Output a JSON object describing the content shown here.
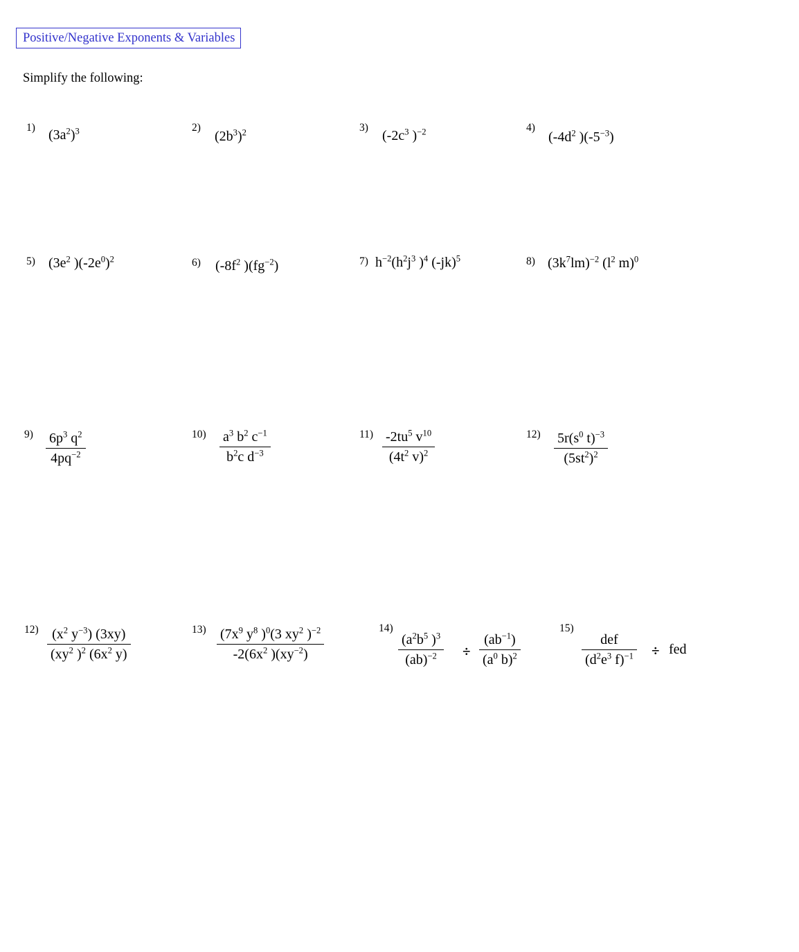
{
  "document": {
    "title": "Positive/Negative Exponents & Variables",
    "instruction": "Simplify the following:",
    "title_border_color": "#3333cc",
    "title_text_color": "#3333cc",
    "background_color": "#ffffff",
    "text_color": "#000000"
  },
  "problems": [
    {
      "number": "1)",
      "kind": "inline",
      "plain": "(3a^2)^3",
      "html": "(3a<sup>2</sup>)<sup>3</sup>"
    },
    {
      "number": "2)",
      "kind": "inline",
      "plain": "(2b^3)^2",
      "html": "(2b<sup>3</sup>)<sup>2</sup>"
    },
    {
      "number": "3)",
      "kind": "inline",
      "plain": "(-2c^3)^-2",
      "html": "(-2c<sup>3</sup> )<sup>&#8722;2</sup>"
    },
    {
      "number": "4)",
      "kind": "inline",
      "plain": "(-4d^2)(-5^-3)",
      "html": "(-4d<sup>2</sup> )(-5<sup>&#8722;3</sup>)"
    },
    {
      "number": "5)",
      "kind": "inline",
      "plain": "(3e^2)(-2e^0)^2",
      "html": "(3e<sup>2</sup> )(-2e<sup>0</sup>)<sup>2</sup>"
    },
    {
      "number": "6)",
      "kind": "inline",
      "plain": "(-8f^2)(fg^-2)",
      "html": "(-8f<sup>2</sup> )(fg<sup>&#8722;2</sup>)"
    },
    {
      "number": "7)",
      "kind": "inline",
      "plain": "h^-2(h^2 j^3)^4 (-jk)^5",
      "html": "h<sup>&#8722;2</sup>(h<sup>2</sup>j<sup>3</sup> )<sup>4</sup> (-jk)<sup>5</sup>"
    },
    {
      "number": "8)",
      "kind": "inline",
      "plain": "(3k^7 lm)^-2 (l^2 m)^0",
      "html": "(3k<sup>7</sup>lm)<sup>&#8722;2</sup> (l<sup>2</sup> m)<sup>0</sup>"
    },
    {
      "number": "9)",
      "kind": "fraction",
      "plain": "6p^3 q^2 / 4pq^-2",
      "numerator_html": "6p<sup>3</sup> q<sup>2</sup>",
      "denominator_html": "4pq<sup>&#8722;2</sup>"
    },
    {
      "number": "10)",
      "kind": "fraction",
      "plain": "a^3 b^2 c^-1 / b^2 c d^-3",
      "numerator_html": "a<sup>3</sup> b<sup>2</sup> c<sup>&#8722;1</sup>",
      "denominator_html": "b<sup>2</sup>c d<sup>&#8722;3</sup>"
    },
    {
      "number": "11)",
      "kind": "fraction",
      "plain": "-2tu^5 v^10 / (4t^2 v)^2",
      "numerator_html": "-2tu<sup>5</sup> v<sup>10</sup>",
      "denominator_html": "(4t<sup>2</sup> v)<sup>2</sup>"
    },
    {
      "number": "12)",
      "kind": "fraction",
      "plain": "5r(s^0 t)^-3 / (5st^2)^2",
      "numerator_html": "5r(s<sup>0</sup> t)<sup>&#8722;3</sup>",
      "denominator_html": "(5st<sup>2</sup>)<sup>2</sup>"
    },
    {
      "number": "12)",
      "kind": "fraction",
      "plain": "(x^2 y^-3)(3xy) / (xy^2)^2 (6x^2 y)",
      "numerator_html": "(x<sup>2</sup> y<sup>&#8722;3</sup>) (3xy)",
      "denominator_html": "(xy<sup>2</sup> )<sup>2</sup> (6x<sup>2</sup> y)"
    },
    {
      "number": "13)",
      "kind": "fraction",
      "plain": "(7x^9 y^8)^0 (3 xy^2)^-2 / -2(6x^2)(xy^-2)",
      "numerator_html": "(7x<sup>9</sup> y<sup>8</sup> )<sup>0</sup>(3 xy<sup>2</sup> )<sup>&#8722;2</sup>",
      "denominator_html": "-2(6x<sup>2</sup> )(xy<sup>&#8722;2</sup>)"
    },
    {
      "number": "14)",
      "kind": "fraction-div-fraction",
      "plain": "(a^2 b^5)^3 / (ab)^-2 ÷ (ab^-1) / (a^0 b)^2",
      "left_numerator_html": "(a<sup>2</sup>b<sup>5</sup> )<sup>3</sup>",
      "left_denominator_html": "(ab)<sup>&#8722;2</sup>",
      "operator": "÷",
      "right_numerator_html": "(ab<sup>&#8722;1</sup>)",
      "right_denominator_html": "(a<sup>0</sup> b)<sup>2</sup>"
    },
    {
      "number": "15)",
      "kind": "fraction-div-term",
      "plain": "def / (d^2 e^3 f)^-1 ÷ fed",
      "numerator_html": "def",
      "denominator_html": "(d<sup>2</sup>e<sup>3</sup> f)<sup>&#8722;1</sup>",
      "operator": "÷",
      "right_term": "fed"
    }
  ]
}
